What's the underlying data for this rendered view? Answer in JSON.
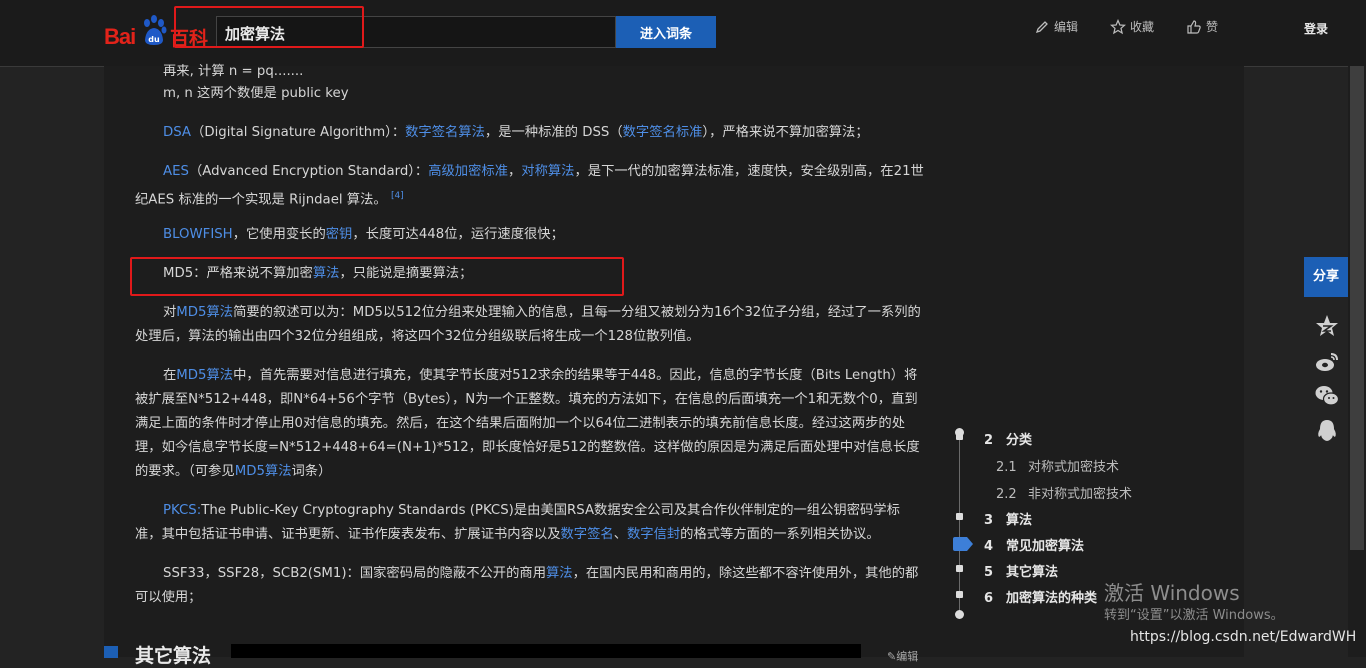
{
  "header": {
    "logo_text": "Bai 百科",
    "logo_left": "Bai",
    "logo_right": "百科",
    "search_value": "加密算法",
    "enter_button": "进入词条",
    "actions": [
      "编辑",
      "收藏",
      "赞"
    ],
    "login": "登录"
  },
  "content": {
    "line1": "再来, 计算 n = pq.......",
    "line2": "m, n 这两个数便是 public key",
    "dsa": {
      "link1": "DSA",
      "t1": "（Digital Signature Algorithm）：",
      "link2": "数字签名算法",
      "t2": "，是一种标准的 DSS（",
      "link3": "数字签名标准",
      "t3": "），严格来说不算加密算法；"
    },
    "aes": {
      "link1": "AES",
      "t1": "（Advanced Encryption Standard）：",
      "link2": "高级加密标准",
      "t2": "，",
      "link3": "对称算法",
      "t3": "，是下一代的加密算法标准，速度快，安全级别高，在21世纪AES 标准的一个实现是 Rijndael 算法。",
      "sup": "[4]"
    },
    "blowfish": {
      "link1": "BLOWFISH",
      "t1": "，它使用变长的",
      "link2": "密钥",
      "t2": "，长度可达448位，运行速度很快；"
    },
    "md5": {
      "t1": "MD5：严格来说不算加密",
      "link1": "算法",
      "t2": "，只能说是摘要算法；"
    },
    "md5desc": {
      "t1": "对",
      "link1": "MD5算法",
      "t2": "简要的叙述可以为：MD5以512位分组来处理输入的信息，且每一分组又被划分为16个32位子分组，经过了一系列的处理后，算法的输出由四个32位分组组成，将这四个32位分组级联后将生成一个128位散列值。"
    },
    "md5pad": {
      "t1": "在",
      "link1": "MD5算法",
      "t2": "中，首先需要对信息进行填充，使其字节长度对512求余的结果等于448。因此，信息的字节长度（Bits Length）将被扩展至N*512+448，即N*64+56个字节（Bytes），N为一个正整数。填充的方法如下，在信息的后面填充一个1和无数个0，直到满足上面的条件时才停止用0对信息的填充。然后，在这个结果后面附加一个以64位二进制表示的填充前信息长度。经过这两步的处理，如今信息字节长度=N*512+448+64=(N+1)*512，即长度恰好是512的整数倍。这样做的原因是为满足后面处理中对信息长度的要求。（可参见",
      "link2": "MD5算法",
      "t3": "词条）"
    },
    "pkcs": {
      "link1": "PKCS:",
      "t1": "The Public-Key Cryptography Standards (PKCS)是由美国RSA数据安全公司及其合作伙伴制定的一组公钥密码学标准，其中包括证书申请、证书更新、证书作废表发布、扩展证书内容以及",
      "link2": "数字签名",
      "t2": "、",
      "link3": "数字信封",
      "t3": "的格式等方面的一系列相关协议。"
    },
    "ssf": {
      "t1": "SSF33，SSF28，SCB2(SM1)：国家密码局的隐蔽不公开的商用",
      "link1": "算法",
      "t2": "，在国内民用和商用的，除这些都不容许使用外，其他的都可以使用；"
    },
    "section_title": "其它算法",
    "section_edit": "编辑"
  },
  "share": {
    "label": "分享"
  },
  "toc": [
    {
      "num": "2",
      "label": "分类"
    },
    {
      "num": "2.1",
      "label": "对称式加密技术"
    },
    {
      "num": "2.2",
      "label": "非对称式加密技术"
    },
    {
      "num": "3",
      "label": "算法"
    },
    {
      "num": "4",
      "label": "常见加密算法"
    },
    {
      "num": "5",
      "label": "其它算法"
    },
    {
      "num": "6",
      "label": "加密算法的种类"
    }
  ],
  "watermark": {
    "line1": "激活 Windows",
    "line2": "转到“设置”以激活 Windows。"
  },
  "csdn": "https://blog.csdn.net/EdwardWH",
  "colors": {
    "accent": "#1c5fb5",
    "link": "#4e8ee6",
    "highlight_box": "#e0191a",
    "logo_red": "#e2231a"
  }
}
